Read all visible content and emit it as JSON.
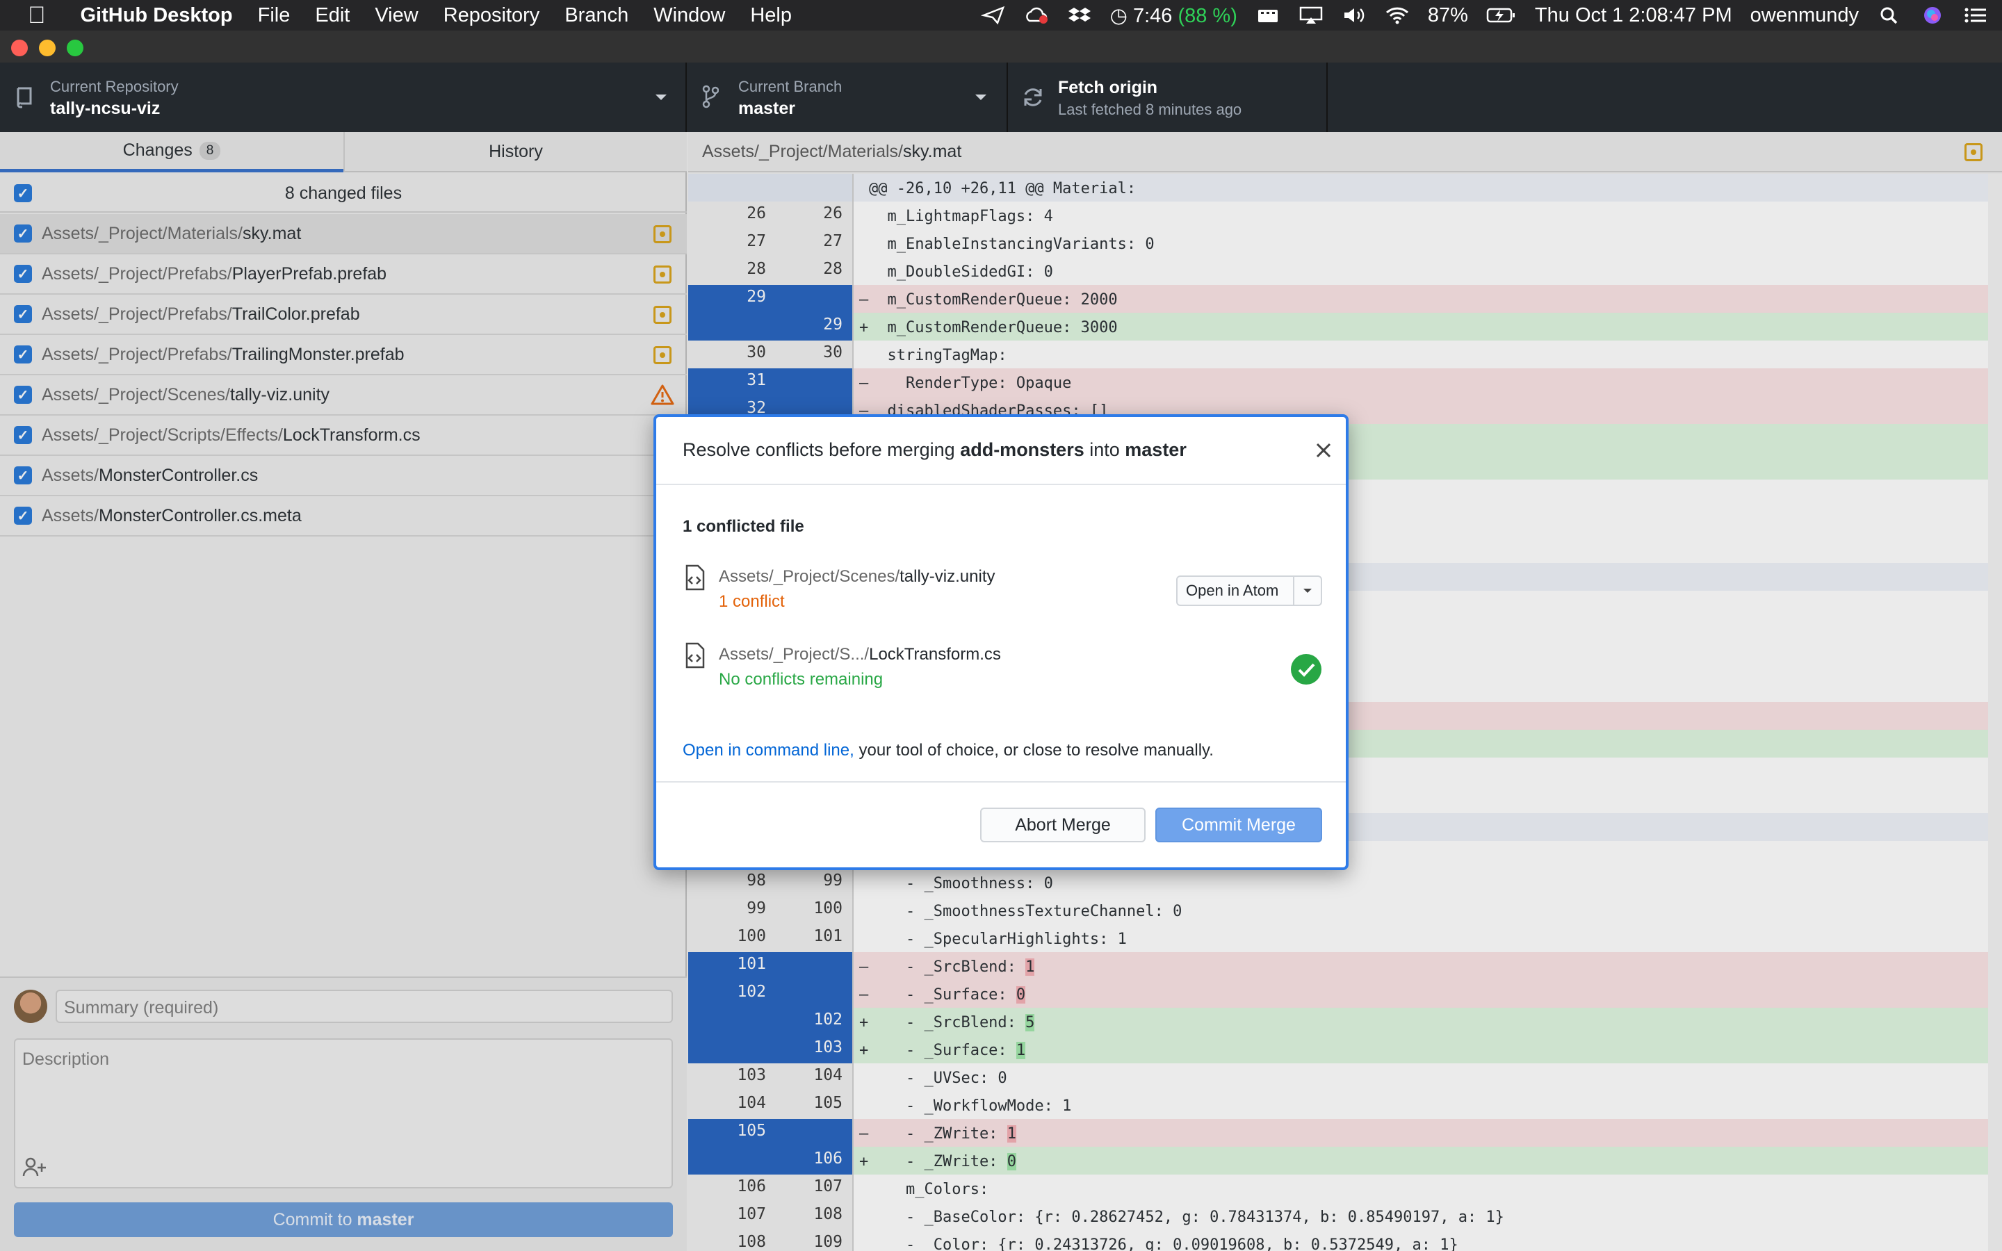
{
  "menubar": {
    "app_name": "GitHub Desktop",
    "menus": [
      "File",
      "Edit",
      "View",
      "Repository",
      "Branch",
      "Window",
      "Help"
    ],
    "clock_icon_text": "7:46",
    "clock_battery": "(88 %)",
    "battery_percent": "87%",
    "datetime": "Thu Oct 1  2:08:47 PM",
    "username": "owenmundy"
  },
  "toolbar": {
    "repo_label": "Current Repository",
    "repo_name": "tally-ncsu-viz",
    "branch_label": "Current Branch",
    "branch_name": "master",
    "fetch_title": "Fetch origin",
    "fetch_sub": "Last fetched 8 minutes ago"
  },
  "tabs": {
    "changes": "Changes",
    "changes_count": "8",
    "history": "History"
  },
  "changes": {
    "header": "8 changed files",
    "files": [
      {
        "dir": "Assets/_Project/Materials/",
        "name": "sky.mat",
        "status": "modified"
      },
      {
        "dir": "Assets/_Project/Prefabs/",
        "name": "PlayerPrefab.prefab",
        "status": "modified"
      },
      {
        "dir": "Assets/_Project/Prefabs/",
        "name": "TrailColor.prefab",
        "status": "modified"
      },
      {
        "dir": "Assets/_Project/Prefabs/",
        "name": "TrailingMonster.prefab",
        "status": "modified"
      },
      {
        "dir": "Assets/_Project/Scenes/",
        "name": "tally-viz.unity",
        "status": "conflict"
      },
      {
        "dir": "Assets/_Project/Scripts/Effects/",
        "name": "LockTransform.cs",
        "status": "modified"
      },
      {
        "dir": "Assets/",
        "name": "MonsterController.cs",
        "status": "modified"
      },
      {
        "dir": "Assets/",
        "name": "MonsterController.cs.meta",
        "status": "modified"
      }
    ]
  },
  "commit": {
    "summary_placeholder": "Summary (required)",
    "description_placeholder": "Description",
    "button_prefix": "Commit to ",
    "button_branch": "master"
  },
  "diff": {
    "path_dir": "Assets/_Project/Materials/",
    "path_name": "sky.mat",
    "top_lines": [
      {
        "type": "hunk",
        "old": "",
        "new": "",
        "text": "@@ -26,10 +26,11 @@ Material:"
      },
      {
        "type": "ctx",
        "old": "26",
        "new": "26",
        "text": "  m_LightmapFlags: 4"
      },
      {
        "type": "ctx",
        "old": "27",
        "new": "27",
        "text": "  m_EnableInstancingVariants: 0"
      },
      {
        "type": "ctx",
        "old": "28",
        "new": "28",
        "text": "  m_DoubleSidedGI: 0"
      },
      {
        "type": "del",
        "old": "29",
        "new": "",
        "text": "  m_CustomRenderQueue: 2000"
      },
      {
        "type": "add",
        "old": "",
        "new": "29",
        "text": "  m_CustomRenderQueue: 3000"
      },
      {
        "type": "ctx",
        "old": "30",
        "new": "30",
        "text": "  stringTagMap:"
      },
      {
        "type": "del",
        "old": "31",
        "new": "",
        "text": "    RenderType: Opaque"
      },
      {
        "type": "del",
        "old": "32",
        "new": "",
        "text": "  disabledShaderPasses: []"
      }
    ],
    "bottom_lines": [
      {
        "type": "ctx",
        "old": "98",
        "new": "99",
        "text": "    - _Smoothness: 0"
      },
      {
        "type": "ctx",
        "old": "99",
        "new": "100",
        "text": "    - _SmoothnessTextureChannel: 0"
      },
      {
        "type": "ctx",
        "old": "100",
        "new": "101",
        "text": "    - _SpecularHighlights: 1"
      },
      {
        "type": "del",
        "old": "101",
        "new": "",
        "text": "    - _SrcBlend: ",
        "hl": "1"
      },
      {
        "type": "del",
        "old": "102",
        "new": "",
        "text": "    - _Surface: ",
        "hl": "0"
      },
      {
        "type": "add",
        "old": "",
        "new": "102",
        "text": "    - _SrcBlend: ",
        "hl": "5"
      },
      {
        "type": "add",
        "old": "",
        "new": "103",
        "text": "    - _Surface: ",
        "hl": "1"
      },
      {
        "type": "ctx",
        "old": "103",
        "new": "104",
        "text": "    - _UVSec: 0"
      },
      {
        "type": "ctx",
        "old": "104",
        "new": "105",
        "text": "    - _WorkflowMode: 1"
      },
      {
        "type": "del",
        "old": "105",
        "new": "",
        "text": "    - _ZWrite: ",
        "hl": "1"
      },
      {
        "type": "add",
        "old": "",
        "new": "106",
        "text": "    - _ZWrite: ",
        "hl": "0"
      },
      {
        "type": "ctx",
        "old": "106",
        "new": "107",
        "text": "    m_Colors:"
      },
      {
        "type": "ctx",
        "old": "107",
        "new": "108",
        "text": "    - _BaseColor: {r: 0.28627452, g: 0.78431374, b: 0.85490197, a: 1}"
      },
      {
        "type": "ctx",
        "old": "108",
        "new": "109",
        "text": "    - _Color: {r: 0.24313726, g: 0.09019608, b: 0.5372549, a: 1}"
      }
    ]
  },
  "modal": {
    "title_prefix": "Resolve conflicts before merging ",
    "title_branch_from": "add-monsters",
    "title_middle": " into ",
    "title_branch_to": "master",
    "conflicted_header": "1 conflicted file",
    "files": [
      {
        "dir": "Assets/_Project/Scenes/",
        "name": "tally-viz.unity",
        "status": "1 conflict"
      },
      {
        "dir": "Assets/_Project/S.../",
        "name": "LockTransform.cs",
        "status": "No conflicts remaining"
      }
    ],
    "open_in_atom": "Open in Atom",
    "cmdline_link": "Open in command line,",
    "cmdline_rest": " your tool of choice, or close to resolve manually.",
    "abort": "Abort Merge",
    "commit": "Commit Merge"
  },
  "colors": {
    "accent": "#2f6bc9",
    "conflict": "#e36209",
    "resolved": "#28a745",
    "modified": "#d8a012",
    "link": "#0366d6"
  }
}
